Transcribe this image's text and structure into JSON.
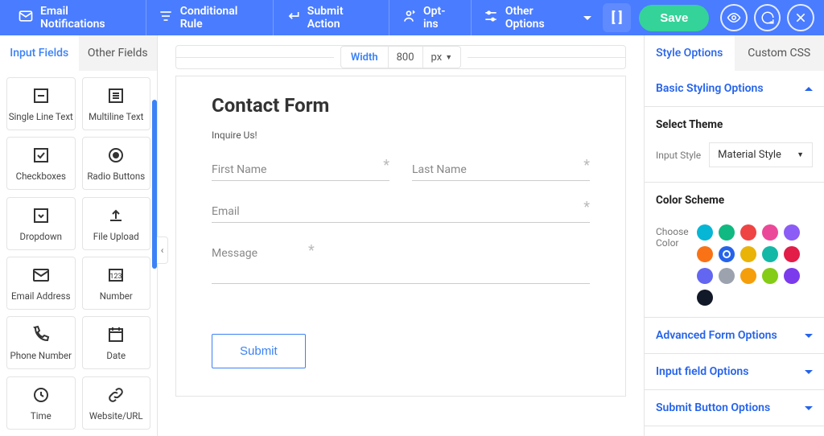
{
  "topbar": {
    "items": [
      {
        "label": "Email Notifications",
        "icon": "mail"
      },
      {
        "label": "Conditional Rule",
        "icon": "filter"
      },
      {
        "label": "Submit Action",
        "icon": "enter"
      },
      {
        "label": "Opt-ins",
        "icon": "optin"
      },
      {
        "label": "Other Options",
        "icon": "sliders",
        "dropdown": true
      }
    ],
    "save_label": "Save"
  },
  "left": {
    "tabs": {
      "input": "Input Fields",
      "other": "Other Fields"
    },
    "fields": [
      {
        "label": "Single Line Text",
        "icon": "sline"
      },
      {
        "label": "Multiline Text",
        "icon": "mline"
      },
      {
        "label": "Checkboxes",
        "icon": "check"
      },
      {
        "label": "Radio Buttons",
        "icon": "radio"
      },
      {
        "label": "Dropdown",
        "icon": "drop"
      },
      {
        "label": "File Upload",
        "icon": "upload"
      },
      {
        "label": "Email Address",
        "icon": "mail"
      },
      {
        "label": "Number",
        "icon": "num"
      },
      {
        "label": "Phone Number",
        "icon": "phone"
      },
      {
        "label": "Date",
        "icon": "date"
      },
      {
        "label": "Time",
        "icon": "time"
      },
      {
        "label": "Website/URL",
        "icon": "link"
      }
    ]
  },
  "canvas": {
    "width_label": "Width",
    "width_value": "800",
    "width_unit": "px",
    "form": {
      "title": "Contact Form",
      "subtitle": "Inquire Us!",
      "fields": {
        "first_name": "First Name",
        "last_name": "Last Name",
        "email": "Email",
        "message": "Message"
      },
      "submit": "Submit"
    }
  },
  "right": {
    "tabs": {
      "style": "Style Options",
      "css": "Custom CSS"
    },
    "sections": {
      "basic": "Basic Styling Options",
      "advanced": "Advanced Form Options",
      "input": "Input field Options",
      "submit": "Submit Button Options"
    },
    "theme_heading": "Select Theme",
    "input_style_label": "Input Style",
    "input_style_value": "Material Style",
    "color_heading": "Color Scheme",
    "choose_color_label": "Choose Color",
    "colors": [
      "#06b6d4",
      "#10b981",
      "#ef4444",
      "#ec4899",
      "#8b5cf6",
      "#f97316",
      "#2563eb",
      "#eab308",
      "#14b8a6",
      "#e11d48",
      "#6366f1",
      "#9ca3af",
      "#f59e0b",
      "#84cc16",
      "#7c3aed",
      "#111827"
    ],
    "selected_color_index": 6
  }
}
